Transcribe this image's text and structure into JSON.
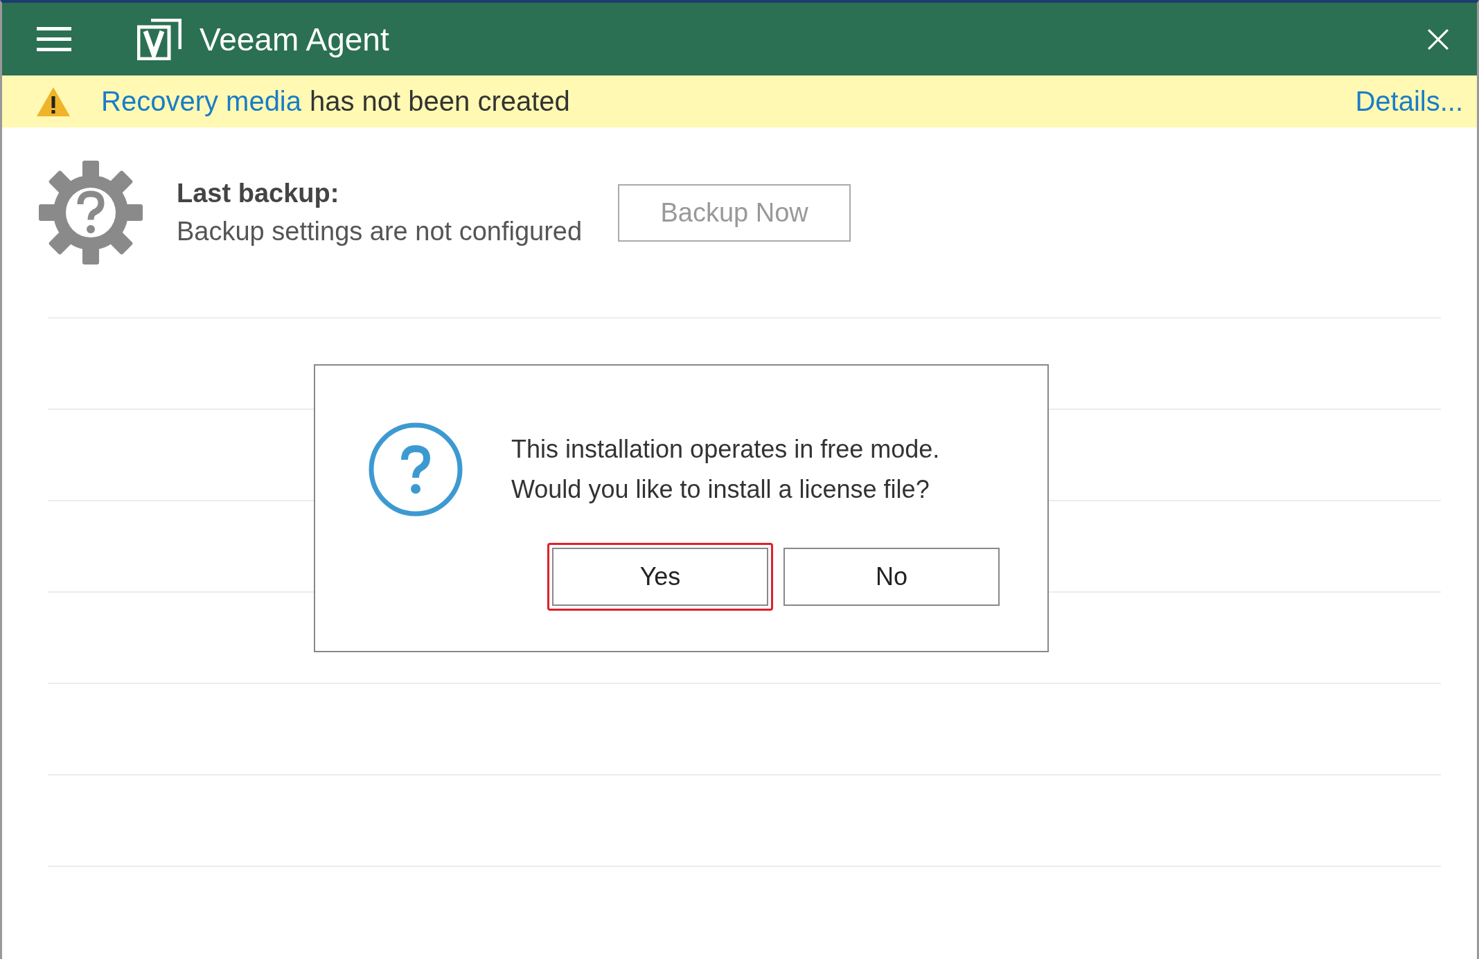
{
  "window": {
    "title": "Veeam Agent"
  },
  "warning": {
    "link": "Recovery media",
    "text": "has not been created",
    "details": "Details..."
  },
  "status": {
    "heading": "Last backup:",
    "text": "Backup settings are not configured",
    "button": {
      "label": "Backup Now",
      "disabled": true
    }
  },
  "dialog": {
    "lines": [
      "This installation operates in free mode.",
      "Would you like to install a license file?"
    ],
    "buttons": [
      {
        "label": "Yes",
        "highlighted": true
      },
      {
        "label": "No",
        "highlighted": false
      }
    ]
  }
}
